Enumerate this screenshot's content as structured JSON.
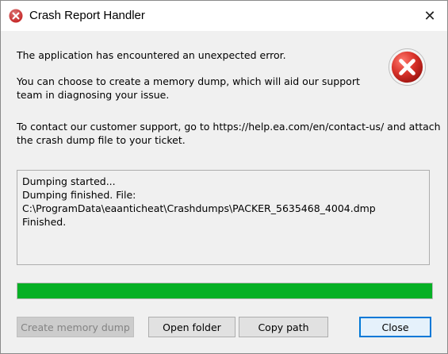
{
  "window": {
    "title": "Crash Report Handler",
    "close_glyph": "✕",
    "title_icon": "error-icon"
  },
  "message": {
    "line1": "The application has encountered an unexpected error.",
    "line2a": "You can choose to create a memory dump, which will aid our support",
    "line2b": "team in diagnosing your issue.",
    "line3a": "To contact our customer support, go to https://help.ea.com/en/contact-us/ and attach",
    "line3b": "the crash dump file to your ticket.",
    "icon": "error-icon"
  },
  "log": {
    "lines": [
      "Dumping started...",
      "Dumping finished. File:",
      "C:\\ProgramData\\eaanticheat\\Crashdumps\\PACKER_5635468_4004.dmp",
      "Finished."
    ]
  },
  "progress": {
    "value_percent": 100,
    "color": "#06b025"
  },
  "buttons": {
    "create_memory_dump": "Create memory dump",
    "open_folder": "Open folder",
    "copy_path": "Copy path",
    "close": "Close"
  },
  "colors": {
    "error_red": "#d32f2f",
    "accent_blue": "#0078d7"
  }
}
